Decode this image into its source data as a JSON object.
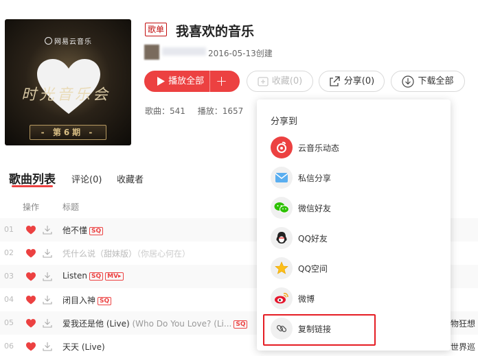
{
  "cover": {
    "brand": "网易云音乐",
    "script_text": "时光音乐会",
    "issue": "- 第6期 -"
  },
  "playlist": {
    "badge": "歌单",
    "title": "我喜欢的音乐",
    "created": "2016-05-13创建",
    "song_count_label": "歌曲：541",
    "play_count_label": "播放：1657"
  },
  "actions": {
    "play_all": "播放全部",
    "add": "+",
    "collect": "收藏(0)",
    "share": "分享(0)",
    "download_all": "下载全部"
  },
  "tabs": {
    "songs": "歌曲列表",
    "comments": "评论(0)",
    "collectors": "收藏者"
  },
  "columns": {
    "operation": "操作",
    "title": "标题"
  },
  "songs": [
    {
      "num": "01",
      "title": "他不懂",
      "alias": "",
      "tags": [
        "SQ"
      ],
      "extra": "",
      "disabled": false
    },
    {
      "num": "02",
      "title": "凭什么说（甜妹版）",
      "alias": "（你居心何在）",
      "tags": [],
      "extra": "",
      "disabled": true
    },
    {
      "num": "03",
      "title": "Listen",
      "alias": "",
      "tags": [
        "SQ",
        "MV▸"
      ],
      "extra": "",
      "disabled": false
    },
    {
      "num": "04",
      "title": "闭目入神",
      "alias": "",
      "tags": [
        "SQ"
      ],
      "extra": "",
      "disabled": false
    },
    {
      "num": "05",
      "title": "爱我还是他 (Live)",
      "alias": " (Who Do You Love? (Li...",
      "tags": [
        "SQ"
      ],
      "extra": "物狂想",
      "disabled": false
    },
    {
      "num": "06",
      "title": "天天 (Live)",
      "alias": "",
      "tags": [],
      "extra": "世界巡",
      "disabled": false
    }
  ],
  "share_popup": {
    "title": "分享到",
    "items": [
      {
        "label": "云音乐动态",
        "icon": "netease-cloud-music-icon"
      },
      {
        "label": "私信分享",
        "icon": "mail-icon"
      },
      {
        "label": "微信好友",
        "icon": "wechat-icon"
      },
      {
        "label": "QQ好友",
        "icon": "qq-icon"
      },
      {
        "label": "QQ空间",
        "icon": "qzone-star-icon"
      },
      {
        "label": "微博",
        "icon": "weibo-icon"
      },
      {
        "label": "复制链接",
        "icon": "link-icon"
      }
    ]
  },
  "colors": {
    "accent": "#ec4141",
    "highlight_box": "#e51c23"
  }
}
